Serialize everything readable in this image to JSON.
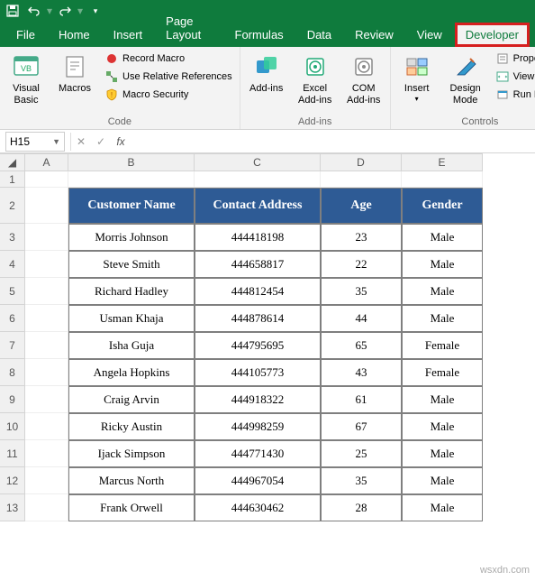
{
  "titlebar": {
    "save": "💾"
  },
  "tabs": {
    "file": "File",
    "home": "Home",
    "insert": "Insert",
    "pagelayout": "Page Layout",
    "formulas": "Formulas",
    "data": "Data",
    "review": "Review",
    "view": "View",
    "developer": "Developer"
  },
  "ribbon": {
    "code": {
      "visual_basic": "Visual Basic",
      "macros": "Macros",
      "record_macro": "Record Macro",
      "use_relative": "Use Relative References",
      "macro_security": "Macro Security",
      "group": "Code"
    },
    "addins": {
      "addins": "Add-ins",
      "excel_addins": "Excel Add-ins",
      "com_addins": "COM Add-ins",
      "group": "Add-ins"
    },
    "controls": {
      "insert": "Insert",
      "design_mode": "Design Mode",
      "properties": "Properties",
      "view_code": "View Code",
      "run_dialog": "Run Dialog",
      "group": "Controls"
    }
  },
  "formula": {
    "namebox": "H15",
    "fx": "fx"
  },
  "columns": [
    "A",
    "B",
    "C",
    "D",
    "E"
  ],
  "headers": {
    "name": "Customer Name",
    "contact": "Contact Address",
    "age": "Age",
    "gender": "Gender"
  },
  "rows": [
    {
      "n": "3",
      "name": "Morris Johnson",
      "contact": "444418198",
      "age": "23",
      "gender": "Male"
    },
    {
      "n": "4",
      "name": "Steve Smith",
      "contact": "444658817",
      "age": "22",
      "gender": "Male"
    },
    {
      "n": "5",
      "name": "Richard Hadley",
      "contact": "444812454",
      "age": "35",
      "gender": "Male"
    },
    {
      "n": "6",
      "name": "Usman Khaja",
      "contact": "444878614",
      "age": "44",
      "gender": "Male"
    },
    {
      "n": "7",
      "name": "Isha Guja",
      "contact": "444795695",
      "age": "65",
      "gender": "Female"
    },
    {
      "n": "8",
      "name": "Angela Hopkins",
      "contact": "444105773",
      "age": "43",
      "gender": "Female"
    },
    {
      "n": "9",
      "name": "Craig Arvin",
      "contact": "444918322",
      "age": "61",
      "gender": "Male"
    },
    {
      "n": "10",
      "name": "Ricky Austin",
      "contact": "444998259",
      "age": "67",
      "gender": "Male"
    },
    {
      "n": "11",
      "name": "Ijack Simpson",
      "contact": "444771430",
      "age": "25",
      "gender": "Male"
    },
    {
      "n": "12",
      "name": "Marcus North",
      "contact": "444967054",
      "age": "35",
      "gender": "Male"
    },
    {
      "n": "13",
      "name": "Frank Orwell",
      "contact": "444630462",
      "age": "28",
      "gender": "Male"
    }
  ],
  "watermark": "wsxdn.com"
}
